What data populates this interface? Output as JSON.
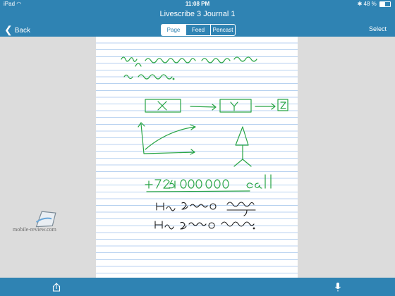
{
  "status_bar": {
    "device": "iPad",
    "time": "11:08 PM",
    "battery": "48 %",
    "battery_level": 0.48
  },
  "nav": {
    "title": "Livescribe 3 Journal 1",
    "back_label": "Back",
    "select_label": "Select"
  },
  "tabs": [
    {
      "label": "Page",
      "active": true
    },
    {
      "label": "Feed",
      "active": false
    },
    {
      "label": "Pencast",
      "active": false
    }
  ],
  "notebook": {
    "handwriting_lines": [
      "Буду одновременно писать",
      "и говорить.",
      "X → Y → Z",
      "+7925 000000 call",
      "Не знаю почему",
      "Не знаю почему."
    ],
    "ink_color": "#27a444"
  },
  "watermark": {
    "text": "mobile-review.com"
  },
  "toolbar": {
    "share_icon": "share-icon",
    "mic_icon": "microphone-icon"
  },
  "colors": {
    "bar": "#2f83b3",
    "canvas": "#dcdcdc"
  }
}
